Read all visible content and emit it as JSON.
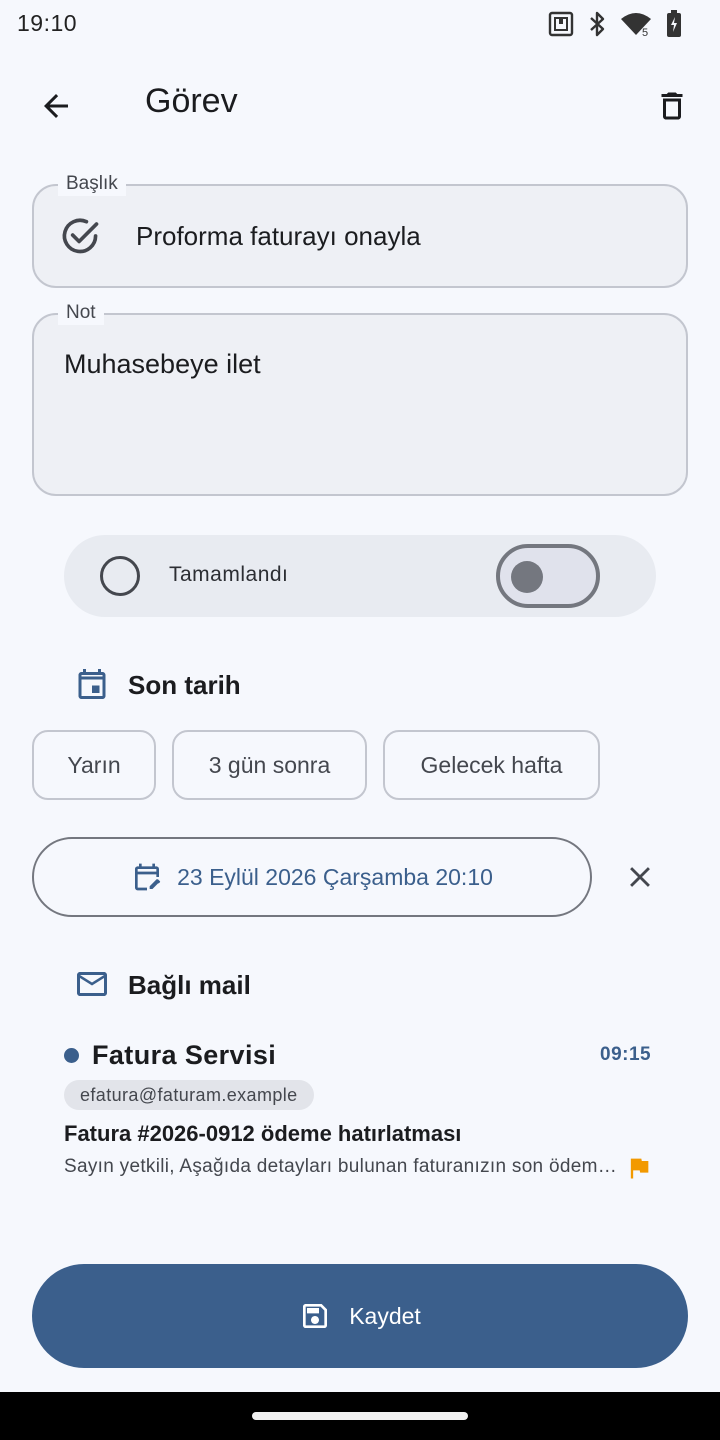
{
  "status_bar": {
    "time": "19:10",
    "icons": [
      "nfc-icon",
      "bluetooth-icon",
      "wifi-icon",
      "battery-icon"
    ],
    "wifi_badge": "5"
  },
  "app_bar": {
    "back_icon": "arrow-back-icon",
    "title": "Görev",
    "delete_icon": "trash-icon"
  },
  "title_field": {
    "label": "Başlık",
    "value": "Proforma faturayı onayla",
    "icon": "check-circle-icon"
  },
  "note_field": {
    "label": "Not",
    "value": "Muhasebeye ilet"
  },
  "completed": {
    "label": "Tamamlandı",
    "checked": false
  },
  "due_section": {
    "icon": "calendar-icon",
    "title": "Son tarih",
    "chips": [
      "Yarın",
      "3 gün sonra",
      "Gelecek hafta"
    ],
    "date_icon": "calendar-edit-icon",
    "date_value": "23 Eylül 2026 Çarşamba 20:10",
    "clear_icon": "close-icon"
  },
  "mail_section": {
    "icon": "mail-icon",
    "title": "Bağlı mail",
    "mail": {
      "sender": "Fatura Servisi",
      "time": "09:15",
      "address": "efatura@faturam.example",
      "subject": "Fatura #2026-0912 ödeme hatırlatması",
      "preview": "Sayın yetkili,  Aşağıda detayları bulunan faturanızın son ödeme tarihi yaklaşmaktadır.",
      "flag_icon": "flag-icon",
      "unread": true
    }
  },
  "save_button": {
    "icon": "save-icon",
    "label": "Kaydet"
  },
  "colors": {
    "primary": "#3b5f8c",
    "background": "#f6f8fd",
    "flag": "#f29900"
  }
}
